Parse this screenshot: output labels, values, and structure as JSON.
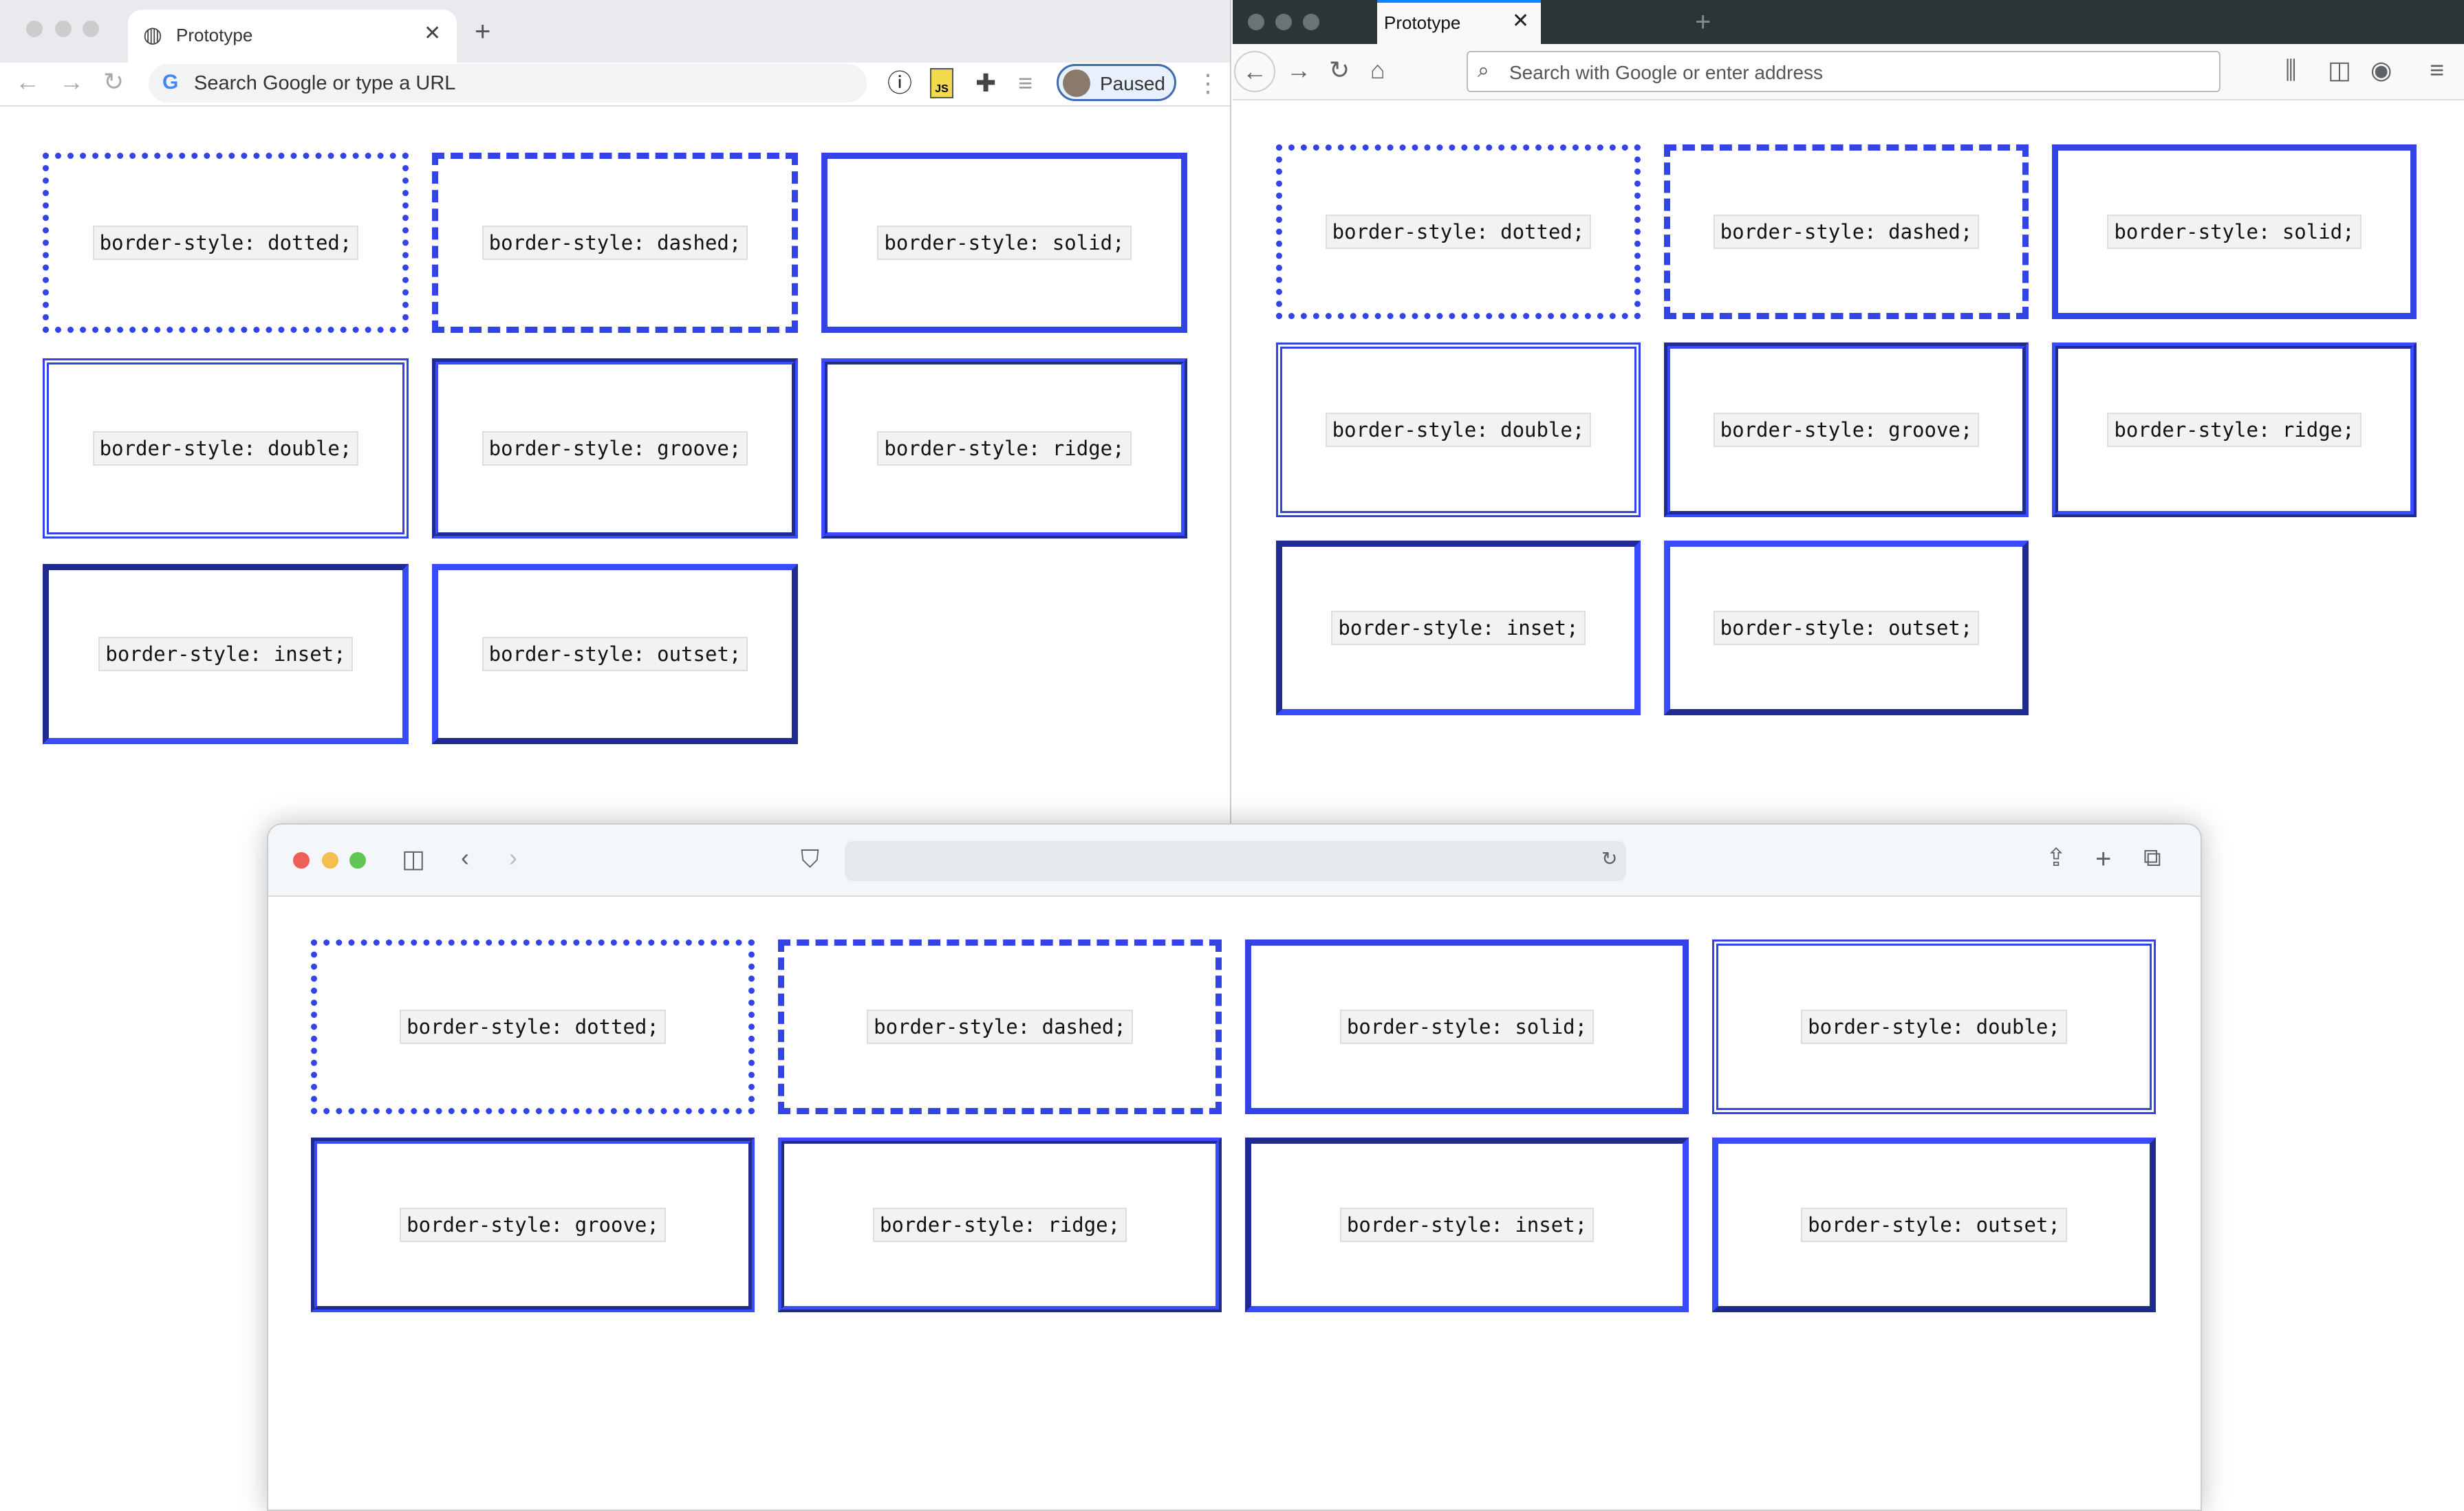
{
  "border_color": "#3344e6",
  "chrome": {
    "tab_title": "Prototype",
    "omnibox_placeholder": "Search Google or type a URL",
    "profile_label": "Paused",
    "extension_label": "JS",
    "boxes": [
      "border-style: dotted;",
      "border-style: dashed;",
      "border-style: solid;",
      "border-style: double;",
      "border-style: groove;",
      "border-style: ridge;",
      "border-style: inset;",
      "border-style: outset;"
    ]
  },
  "firefox": {
    "tab_title": "Prototype",
    "url_placeholder": "Search with Google or enter address",
    "boxes": [
      "border-style: dotted;",
      "border-style: dashed;",
      "border-style: solid;",
      "border-style: double;",
      "border-style: groove;",
      "border-style: ridge;",
      "border-style: inset;",
      "border-style: outset;"
    ]
  },
  "safari": {
    "boxes": [
      "border-style: dotted;",
      "border-style: dashed;",
      "border-style: solid;",
      "border-style: double;",
      "border-style: groove;",
      "border-style: ridge;",
      "border-style: inset;",
      "border-style: outset;"
    ]
  },
  "styles": [
    "dotted",
    "dashed",
    "solid",
    "double",
    "groove",
    "ridge",
    "inset",
    "outset"
  ]
}
